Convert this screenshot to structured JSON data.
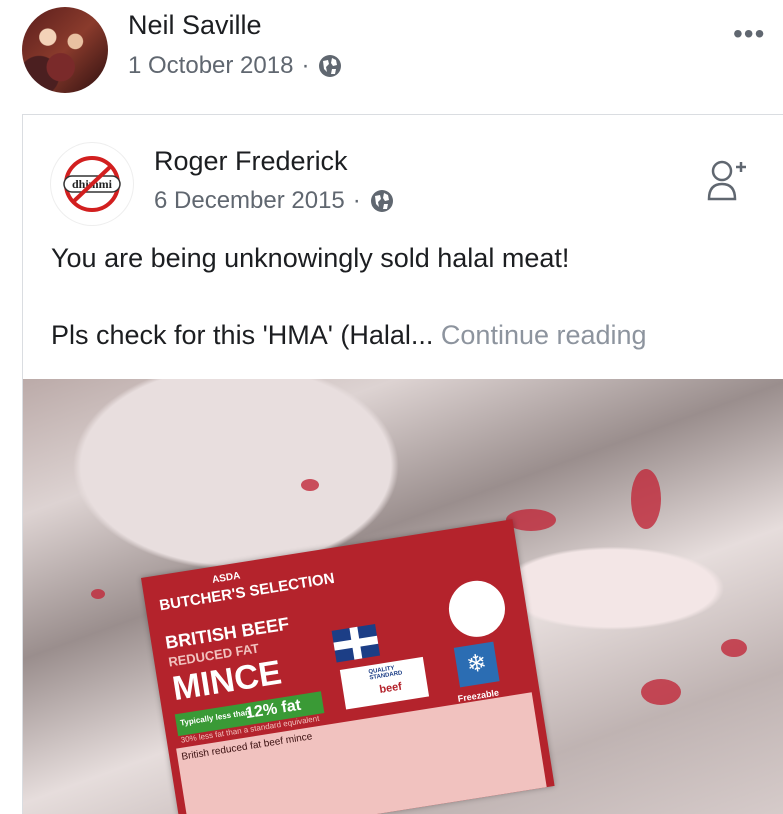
{
  "outer_post": {
    "author": "Neil Saville",
    "date": "1 October 2018",
    "separator": "·",
    "more_icon": "•••"
  },
  "shared_post": {
    "author": "Roger Frederick",
    "date": "6 December 2015",
    "separator": "·",
    "avatar_text": "dhimmi",
    "text_line1": "You are being unknowingly sold halal meat!",
    "text_line2": "Pls check for this 'HMA' (Halal...",
    "continue_reading": "Continue reading"
  },
  "photo_label": {
    "brand_small": "ASDA",
    "brand": "BUTCHER'S SELECTION",
    "line1": "BRITISH BEEF",
    "line2": "REDUCED FAT",
    "product": "MINCE",
    "fat_prefix": "Typically less than",
    "fat": "12% fat",
    "small1": "30% less fat than a standard equivalent",
    "small2": "British reduced fat beef mince",
    "quality": "QUALITY STANDARD",
    "beef": "beef",
    "freezable": "Freezable"
  },
  "colors": {
    "label_red": "#b4232c",
    "meta_gray": "#606770",
    "more_gray": "#8d949e"
  }
}
